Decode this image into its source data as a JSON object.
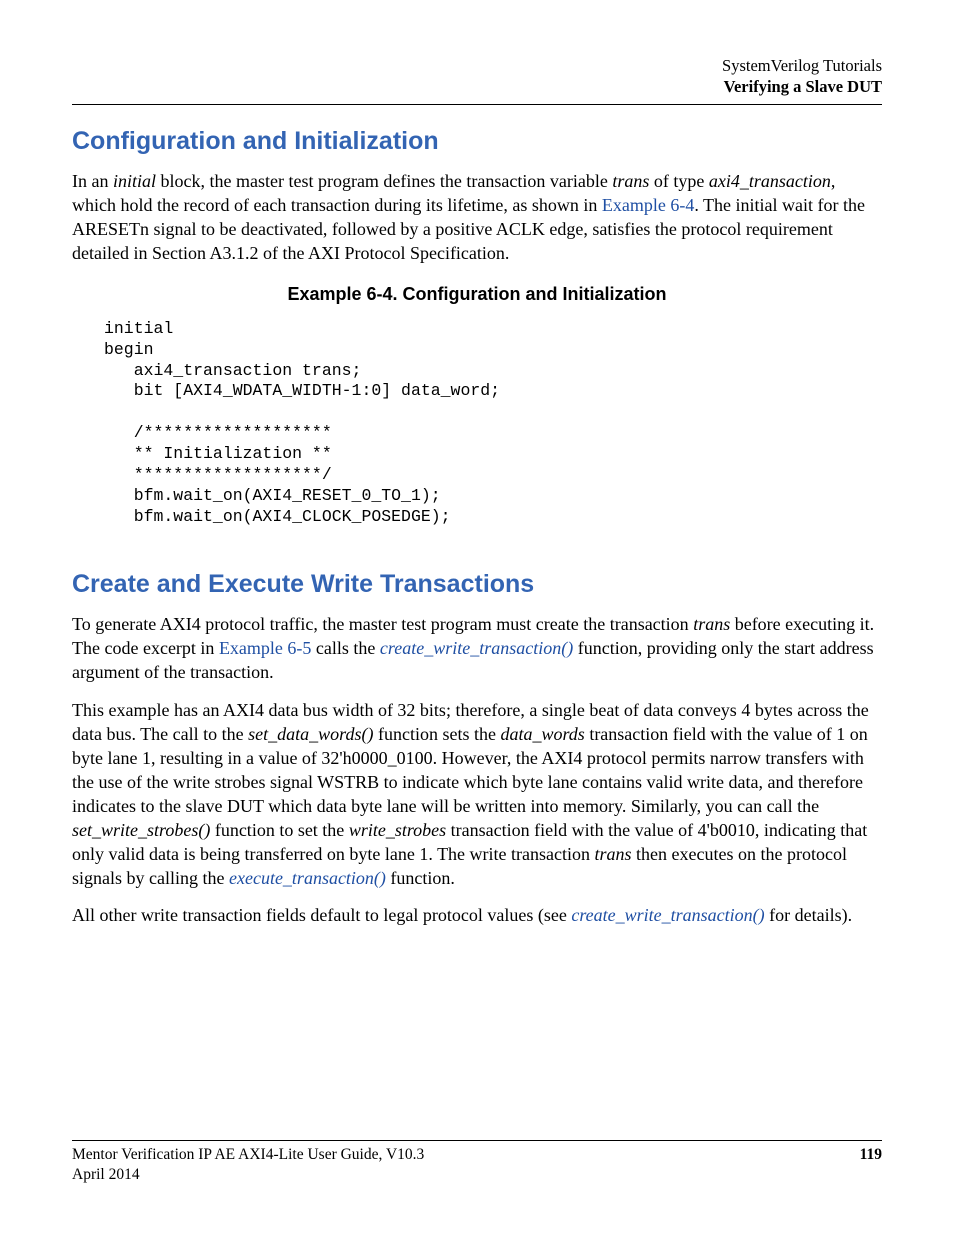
{
  "header": {
    "line1": "SystemVerilog Tutorials",
    "line2": "Verifying a Slave DUT"
  },
  "section1": {
    "title": "Configuration and Initialization",
    "p1_a": "In an ",
    "p1_b": "initial",
    "p1_c": " block, the master test program defines the transaction variable ",
    "p1_d": "trans",
    "p1_e": " of type ",
    "p1_f": "axi4_transaction",
    "p1_g": ", which hold the record of each transaction during its lifetime, as shown in ",
    "p1_h": "Example 6-4",
    "p1_i": ". The initial wait for the ARESETn signal to be deactivated, followed by a positive ACLK edge, satisfies the protocol requirement detailed in Section A3.1.2 of the AXI Protocol Specification.",
    "example_caption": "Example 6-4. Configuration and Initialization",
    "code": "initial\nbegin\n   axi4_transaction trans;\n   bit [AXI4_WDATA_WIDTH-1:0] data_word;\n\n   /*******************\n   ** Initialization **\n   *******************/\n   bfm.wait_on(AXI4_RESET_0_TO_1);\n   bfm.wait_on(AXI4_CLOCK_POSEDGE);"
  },
  "section2": {
    "title": "Create and Execute Write Transactions",
    "p1_a": "To generate AXI4 protocol traffic, the master test program must create the transaction ",
    "p1_b": "trans",
    "p1_c": " before executing it. The code excerpt in ",
    "p1_d": "Example 6-5",
    "p1_e": " calls the ",
    "p1_f": "create_write_transaction()",
    "p1_g": " function, providing only the start address argument of the transaction.",
    "p2_a": "This example has an AXI4 data bus width of 32 bits; therefore, a single beat of data conveys 4 bytes across the data bus. The call to the ",
    "p2_b": "set_data_words()",
    "p2_c": " function sets the ",
    "p2_d": "data_words",
    "p2_e": " transaction field with the value of 1 on byte lane 1, resulting in a value of 32'h0000_0100. However, the AXI4 protocol permits narrow transfers with the use of the write strobes signal WSTRB to indicate which byte lane contains valid write data, and therefore indicates to the slave DUT which data byte lane will be written into memory. Similarly, you can call the ",
    "p2_f": "set_write_strobes()",
    "p2_g": " function to set the ",
    "p2_h": "write_strobes",
    "p2_i": " transaction field with the value of 4'b0010, indicating that only valid data is being transferred on byte lane 1. The write transaction ",
    "p2_j": "trans",
    "p2_k": " then executes on the protocol signals by calling the ",
    "p2_l": "execute_transaction()",
    "p2_m": " function.",
    "p3_a": "All other write transaction fields default to legal protocol values (see ",
    "p3_b": "create_write_transaction()",
    "p3_c": " for details)."
  },
  "footer": {
    "doc": "Mentor Verification IP AE AXI4-Lite User Guide, V10.3",
    "date": "April 2014",
    "page": "119"
  }
}
